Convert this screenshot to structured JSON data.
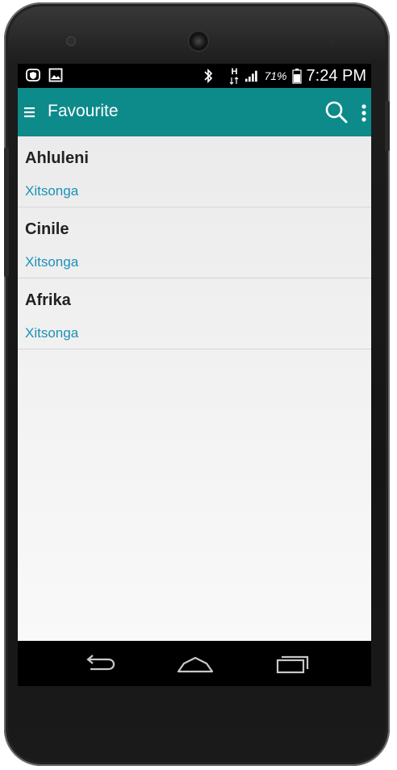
{
  "status_bar": {
    "battery_percent": "71%",
    "time": "7:24 PM",
    "network_type": "H",
    "icons": [
      "shield-notification-icon",
      "gallery-notification-icon",
      "bluetooth-icon",
      "data-arrows-icon",
      "signal-icon",
      "battery-icon"
    ]
  },
  "toolbar": {
    "title": "Favourite",
    "background_color": "#0d8a8a",
    "icons": [
      "menu-icon",
      "search-icon",
      "overflow-menu-icon"
    ]
  },
  "favourites": [
    {
      "word": "Ahluleni",
      "language": "Xitsonga"
    },
    {
      "word": "Cinile",
      "language": "Xitsonga"
    },
    {
      "word": "Afrika",
      "language": "Xitsonga"
    }
  ],
  "accent_colors": {
    "language_text": "#1a91b8",
    "title_text": "#222222"
  },
  "nav_bar": {
    "buttons": [
      "back-icon",
      "home-icon",
      "recent-apps-icon"
    ]
  }
}
